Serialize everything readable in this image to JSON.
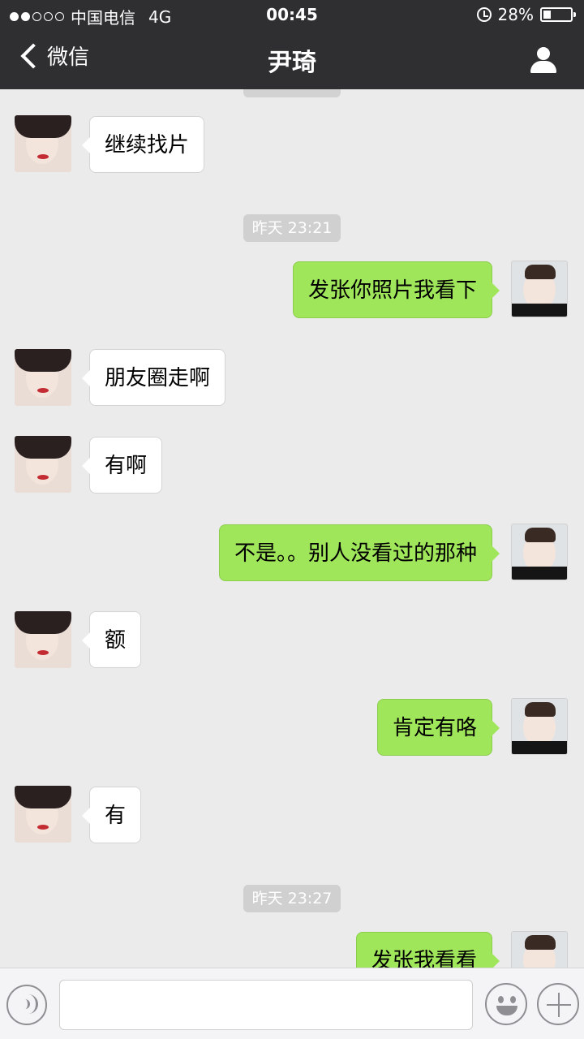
{
  "status_bar": {
    "carrier": "中国电信",
    "network": "4G",
    "time": "00:45",
    "battery_text": "28%",
    "battery_level": 0.28,
    "signal_bars_filled": 2,
    "signal_bars_total": 5
  },
  "nav": {
    "back_label": "微信",
    "title": "尹琦"
  },
  "timestamps": [
    "昨天 23:21",
    "昨天 23:27"
  ],
  "messages": [
    {
      "side": "in",
      "text": "继续找片"
    },
    {
      "side": "out",
      "text": "发张你照片我看下"
    },
    {
      "side": "in",
      "text": "朋友圈走啊"
    },
    {
      "side": "in",
      "text": "有啊"
    },
    {
      "side": "out",
      "text": "不是。。别人没看过的那种"
    },
    {
      "side": "in",
      "text": "额"
    },
    {
      "side": "out",
      "text": "肯定有咯"
    },
    {
      "side": "in",
      "text": "有"
    },
    {
      "side": "out",
      "text": "发张我看看"
    }
  ],
  "input": {
    "value": "",
    "placeholder": ""
  },
  "icons": {
    "back": "chevron-left-icon",
    "profile": "person-icon",
    "voice": "voice-icon",
    "emoji": "emoji-icon",
    "more": "plus-icon",
    "alarm": "alarm-icon"
  },
  "colors": {
    "header_bg": "#2f2f31",
    "chat_bg": "#ebebeb",
    "outgoing_bubble": "#9fe65b",
    "incoming_bubble": "#ffffff"
  }
}
